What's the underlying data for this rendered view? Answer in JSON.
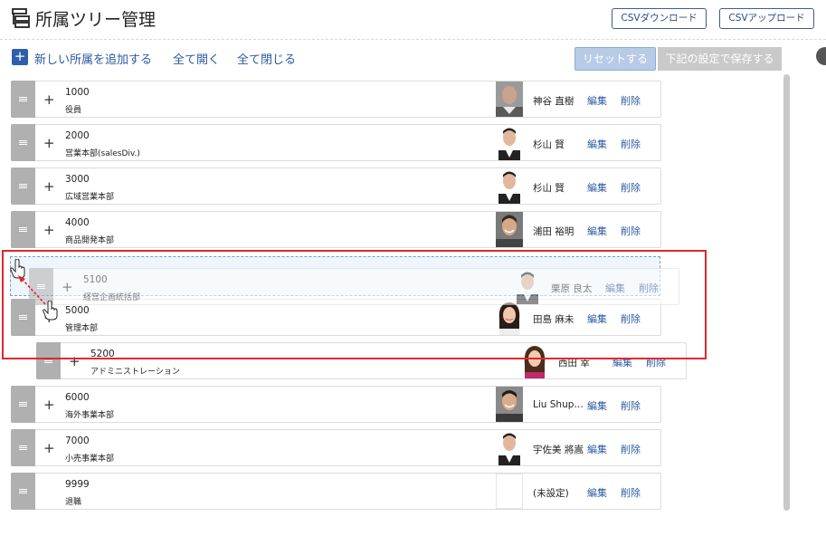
{
  "header": {
    "title": "所属ツリー管理",
    "csv_download": "CSVダウンロード",
    "csv_upload": "CSVアップロード"
  },
  "toolbar": {
    "add_label": "新しい所属を追加する",
    "open_all": "全て開く",
    "close_all": "全て閉じる",
    "reset": "リセットする",
    "save": "下記の設定で保存する"
  },
  "rows": [
    {
      "code": "1000",
      "name": "役員",
      "person": "神谷 直樹",
      "edit": "編集",
      "del": "削除"
    },
    {
      "code": "2000",
      "name": "営業本部(salesDiv.)",
      "person": "杉山 賢",
      "edit": "編集",
      "del": "削除"
    },
    {
      "code": "3000",
      "name": "広域営業本部",
      "person": "杉山 賢",
      "edit": "編集",
      "del": "削除"
    },
    {
      "code": "4000",
      "name": "商品開発本部",
      "person": "浦田 裕明",
      "edit": "編集",
      "del": "削除"
    },
    {
      "code": "5100",
      "name": "経営企画統括部",
      "person": "栗原 良太",
      "edit": "編集",
      "del": "削除"
    },
    {
      "code": "5000",
      "name": "管理本部",
      "person": "田島 麻未",
      "edit": "編集",
      "del": "削除"
    },
    {
      "code": "5200",
      "name": "アドミニストレーション",
      "person": "西田 幸",
      "edit": "編集",
      "del": "削除"
    },
    {
      "code": "6000",
      "name": "海外事業本部",
      "person": "Liu Shup…",
      "edit": "編集",
      "del": "削除"
    },
    {
      "code": "7000",
      "name": "小売事業本部",
      "person": "宇佐美 將嵩",
      "edit": "編集",
      "del": "削除"
    },
    {
      "code": "9999",
      "name": "退職",
      "person": "(未設定)",
      "edit": "編集",
      "del": "削除"
    }
  ],
  "expand_symbol": "+",
  "colors": {
    "accent": "#2c5aa0",
    "handle": "#b0b0b0",
    "highlight": "#e0282e",
    "drop_zone": "#6f9fd8"
  }
}
